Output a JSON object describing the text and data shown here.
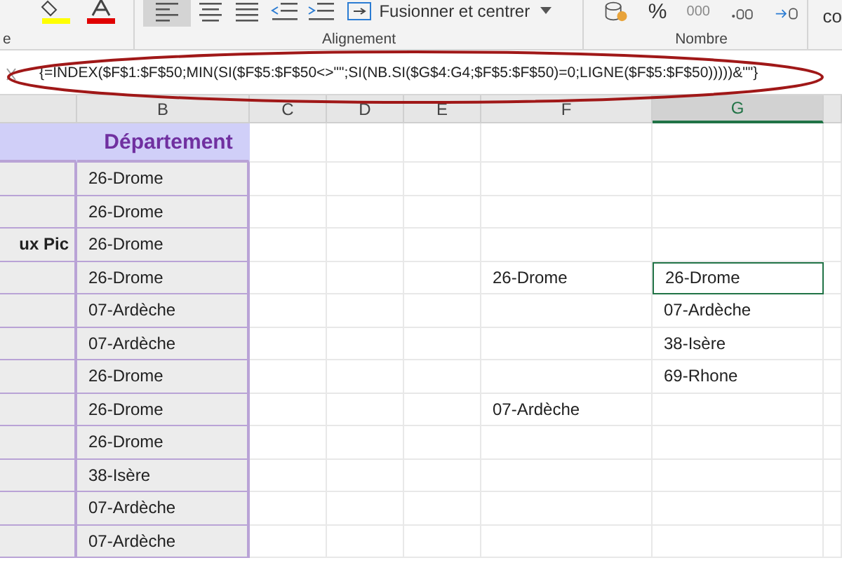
{
  "ribbon": {
    "merge_button": "Fusionner et centrer",
    "groups": [
      {
        "kind": "font",
        "label": "e"
      },
      {
        "kind": "alignment",
        "label": "Alignement"
      },
      {
        "kind": "number",
        "label": "Nombre"
      }
    ],
    "percent": "%",
    "thousands": "000",
    "cut_label": "co"
  },
  "formula_bar": {
    "formula": "{=INDEX($F$1:$F$50;MIN(SI($F$5:$F$50<>\"\";SI(NB.SI($G$4:G4;$F$5:$F$50)=0;LIGNE($F$5:$F$50)))))&\"\"}",
    "highlighted": true
  },
  "columns": [
    {
      "selected": false
    },
    {
      "label": "B",
      "selected": false
    },
    {
      "label": "C",
      "selected": false
    },
    {
      "label": "D",
      "selected": false
    },
    {
      "label": "E",
      "selected": false
    },
    {
      "label": "F",
      "selected": false
    },
    {
      "label": "G",
      "selected": true
    }
  ],
  "rows": [
    {
      "kind": "header",
      "active": false,
      "column_2": "Département"
    },
    {
      "kind": "data",
      "active": false,
      "column_2": "26-Drome"
    },
    {
      "kind": "data",
      "active": false,
      "column_2": "26-Drome"
    },
    {
      "kind": "data",
      "active": false,
      "column_1": "ux Pic",
      "column_2": "26-Drome"
    },
    {
      "kind": "data",
      "active": true,
      "column_2": "26-Drome",
      "column_6": "26-Drome",
      "column_7": "26-Drome"
    },
    {
      "kind": "data",
      "active": false,
      "column_2": "07-Ardèche",
      "column_7": "07-Ardèche"
    },
    {
      "kind": "data",
      "active": false,
      "column_2": "07-Ardèche",
      "column_7": "38-Isère"
    },
    {
      "kind": "data",
      "active": false,
      "column_2": "26-Drome",
      "column_7": "69-Rhone"
    },
    {
      "kind": "data",
      "active": false,
      "column_2": "26-Drome",
      "column_6": "07-Ardèche"
    },
    {
      "kind": "data",
      "active": false,
      "column_2": "26-Drome"
    },
    {
      "kind": "data",
      "active": false,
      "column_2": "38-Isère"
    },
    {
      "kind": "data",
      "active": false,
      "column_2": "07-Ardèche"
    },
    {
      "kind": "data",
      "active": false,
      "column_2": "07-Ardèche"
    }
  ]
}
